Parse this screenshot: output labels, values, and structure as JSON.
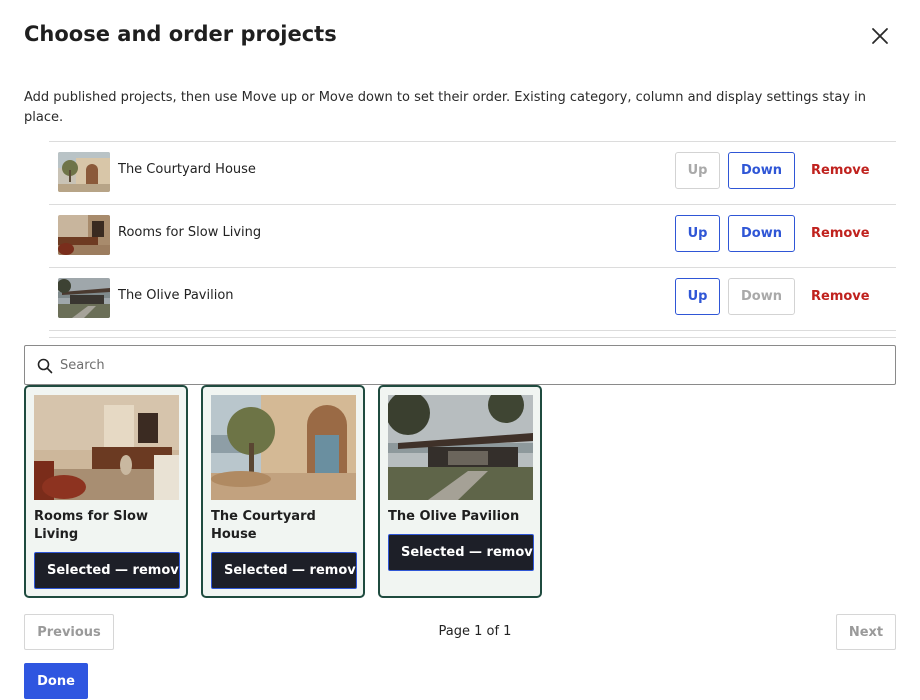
{
  "dialog": {
    "title": "Choose and order projects",
    "intro": "Add published projects, then use Move up or Move down to set their order. Existing category, column and display settings stay in place."
  },
  "order_list": [
    {
      "name": "The Courtyard House",
      "up": "Up",
      "down": "Down",
      "remove": "Remove",
      "up_enabled": false,
      "down_enabled": true
    },
    {
      "name": "Rooms for Slow Living",
      "up": "Up",
      "down": "Down",
      "remove": "Remove",
      "up_enabled": true,
      "down_enabled": true
    },
    {
      "name": "The Olive Pavilion",
      "up": "Up",
      "down": "Down",
      "remove": "Remove",
      "up_enabled": true,
      "down_enabled": false
    }
  ],
  "search": {
    "placeholder": "Search",
    "value": ""
  },
  "results": [
    {
      "title": "Rooms for Slow Living",
      "button": "Selected — remove"
    },
    {
      "title": "The Courtyard House",
      "button": "Selected — remove"
    },
    {
      "title": "The Olive Pavilion",
      "button": "Selected — remove"
    }
  ],
  "pagination": {
    "previous": "Previous",
    "page_text": "Page 1 of 1",
    "next": "Next"
  },
  "footer": {
    "done": "Done"
  },
  "colors": {
    "accent": "#2f56e0",
    "danger": "#c0221e",
    "card_border": "#1f4b3f",
    "selected_button": "#1d1f28"
  }
}
